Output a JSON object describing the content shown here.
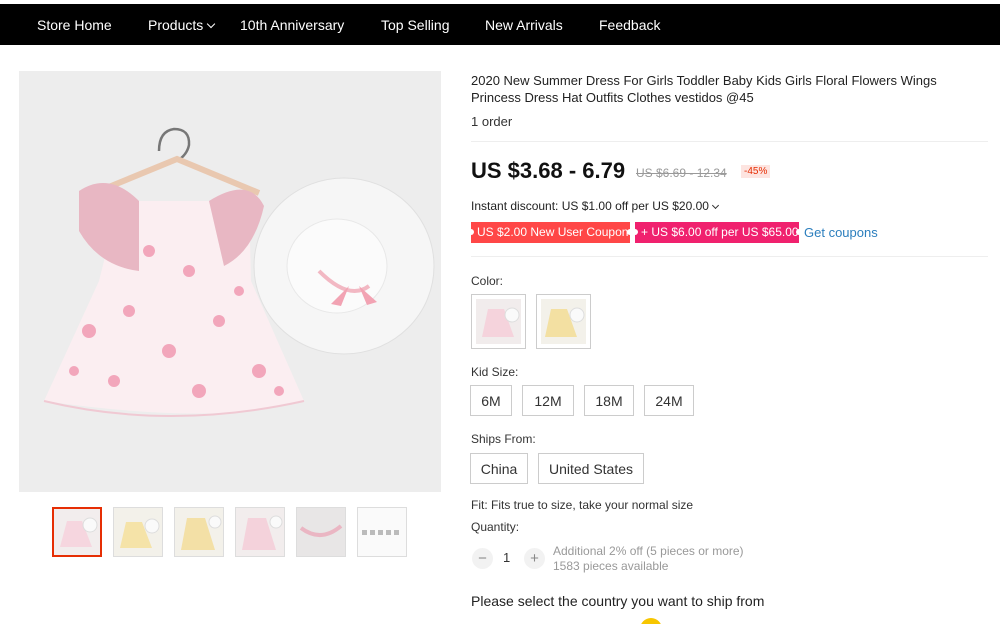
{
  "nav": {
    "items": [
      "Store Home",
      "Products",
      "10th Anniversary",
      "Top Selling",
      "New Arrivals",
      "Feedback"
    ]
  },
  "product": {
    "title": "2020 New Summer Dress For Girls Toddler Baby Kids Girls Floral Flowers Wings Princess Dress Hat Outfits Clothes vestidos @45",
    "orders": "1 order",
    "price": "US $3.68 - 6.79",
    "original_price": "US $6.69 - 12.34",
    "discount": "-45%",
    "instant_discount": "Instant discount: US $1.00 off per US $20.00",
    "coupon_new_user": "US $2.00 New User Coupon",
    "coupon_store": "+ US $6.00 off per US $65.00",
    "get_coupons": "Get coupons"
  },
  "options": {
    "color_label": "Color:",
    "kid_size_label": "Kid Size:",
    "sizes": [
      "6M",
      "12M",
      "18M",
      "24M"
    ],
    "ships_from_label": "Ships From:",
    "ships_from": [
      "China",
      "United States"
    ]
  },
  "fit": "Fit: Fits true to size, take your normal size",
  "quantity": {
    "label": "Quantity:",
    "value": "1",
    "minus": "−",
    "plus": "+",
    "additional": "Additional 2% off (5 pieces or more)",
    "available": "1583 pieces available"
  },
  "ship_message": "Please select the country you want to ship from",
  "colors": {
    "accent": "#e62e04",
    "coupon_red": "#ff4747",
    "coupon_pink": "#f0216e",
    "link": "#2b7ebd"
  }
}
